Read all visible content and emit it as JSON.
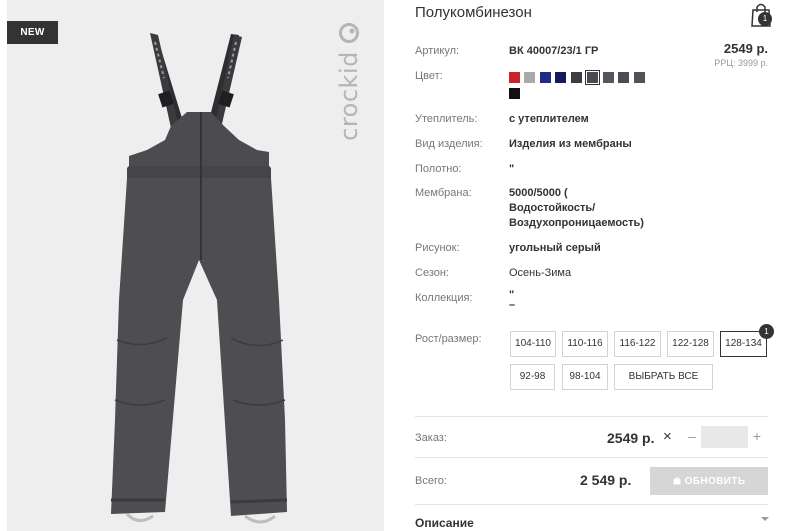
{
  "badge": {
    "label": "NEW"
  },
  "brand": {
    "wordmark": "crockid"
  },
  "product": {
    "title": "Полукомбинезон"
  },
  "cart": {
    "count": "1",
    "icon": "shopping-bag-icon"
  },
  "attributes": {
    "article": {
      "label": "Артикул:",
      "value": "ВК 40007/23/1 ГР"
    },
    "color": {
      "label": "Цвет:"
    },
    "insulation": {
      "label": "Утеплитель:",
      "value": "с утеплителем"
    },
    "item_type": {
      "label": "Вид изделия:",
      "value": "Изделия из мембраны"
    },
    "fabric": {
      "label": "Полотно:",
      "value": "\""
    },
    "membrane": {
      "label": "Мембрана:",
      "value_lines": [
        "5000/5000 (",
        "Водостойкость/",
        "Воздухопроницаемость)"
      ]
    },
    "pattern": {
      "label": "Рисунок:",
      "value": "угольный серый"
    },
    "season": {
      "label": "Сезон:",
      "value": "Осень-Зима"
    },
    "collection": {
      "label": "Коллекция:",
      "value_lines": [
        "\"",
        "–"
      ]
    }
  },
  "price": {
    "main": "2549 р.",
    "rrp": "РРЦ: 3999 р."
  },
  "swatches": [
    {
      "color": "#cc2229",
      "selected": false
    },
    {
      "color": "#a9a9a9",
      "selected": false
    },
    {
      "color": "#1f2a8a",
      "selected": false
    },
    {
      "color": "#15195e",
      "selected": false
    },
    {
      "color": "#3c3c44",
      "selected": false
    },
    {
      "color": "#4a4a4f",
      "selected": true
    },
    {
      "color": "#55565b",
      "selected": false
    },
    {
      "color": "#4b4d52",
      "selected": false
    },
    {
      "color": "#505257",
      "selected": false
    },
    {
      "color": "#111111",
      "selected": false
    }
  ],
  "sizes": {
    "label": "Рост/размер:",
    "options": [
      "104-110",
      "110-116",
      "116-122",
      "122-128",
      "128-134",
      "92-98",
      "98-104"
    ],
    "active": "128-134",
    "active_count": "1",
    "select_all": "ВЫБРАТЬ ВСЕ"
  },
  "order": {
    "label": "Заказ:",
    "price": "2549 р.",
    "remove_symbol": "×",
    "minus": "–",
    "plus": "+",
    "quantity": ""
  },
  "total": {
    "label": "Всего:",
    "value": "2 549 р.",
    "update_button": "ОБНОВИТЬ"
  },
  "description": {
    "title": "Описание"
  },
  "colors": {
    "text": "#333333",
    "muted": "#777777",
    "image_bg": "#eeeeee",
    "button_disabled": "#d6d6d6"
  }
}
